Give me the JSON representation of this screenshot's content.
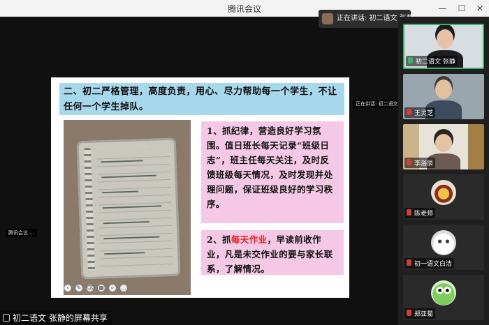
{
  "window": {
    "title": "腾讯会议",
    "buttons": {
      "minimize": "—",
      "maximize": "☐",
      "close": "✕"
    }
  },
  "speaking_indicator": {
    "text": "正在讲话: 初二语文 张静;"
  },
  "slide": {
    "heading": "二、初二严格管理，高度负责，用心、尽力帮助每一个学生，不让任何一个学生掉队。",
    "point1": "1、抓纪律，营造良好学习氛围。值日班长每天记录“班级日志”，班主任每天关注，及时反馈班级每天情况，及时发现并处理问题，保证班级良好的学习秩序。",
    "point2_prefix": "2、抓",
    "point2_highlight": "每天作业",
    "point2_suffix": "，早读前收作业，凡是未交作业的要与家长联系，了解情况。",
    "speaking_mini_tag": "正在讲话: 初二语文 张静",
    "left_mini_tag": "腾讯会议 ...",
    "toolbar_icons": [
      "prev-icon",
      "pen-icon",
      "eraser-icon",
      "grid-icon",
      "zoom-icon",
      "more-icon"
    ]
  },
  "share_bar": {
    "text": "初二语文 张静的屏幕共享"
  },
  "participants": [
    {
      "name": "初二语文 张静",
      "mic": "on",
      "active": true
    },
    {
      "name": "王灵芝",
      "mic": "off",
      "active": false
    },
    {
      "name": "李浴辰",
      "mic": "off",
      "active": false
    },
    {
      "name": "陈老师",
      "mic": "off",
      "active": false
    },
    {
      "name": "初一语文白洁",
      "mic": "off",
      "active": false
    },
    {
      "name": "郑亚菊",
      "mic": "off",
      "active": false
    }
  ],
  "colors": {
    "heading_bg": "#a7d8ec",
    "box_bg": "#f5c9e5",
    "highlight": "#e21d1d",
    "active_border": "#3bb36a"
  }
}
